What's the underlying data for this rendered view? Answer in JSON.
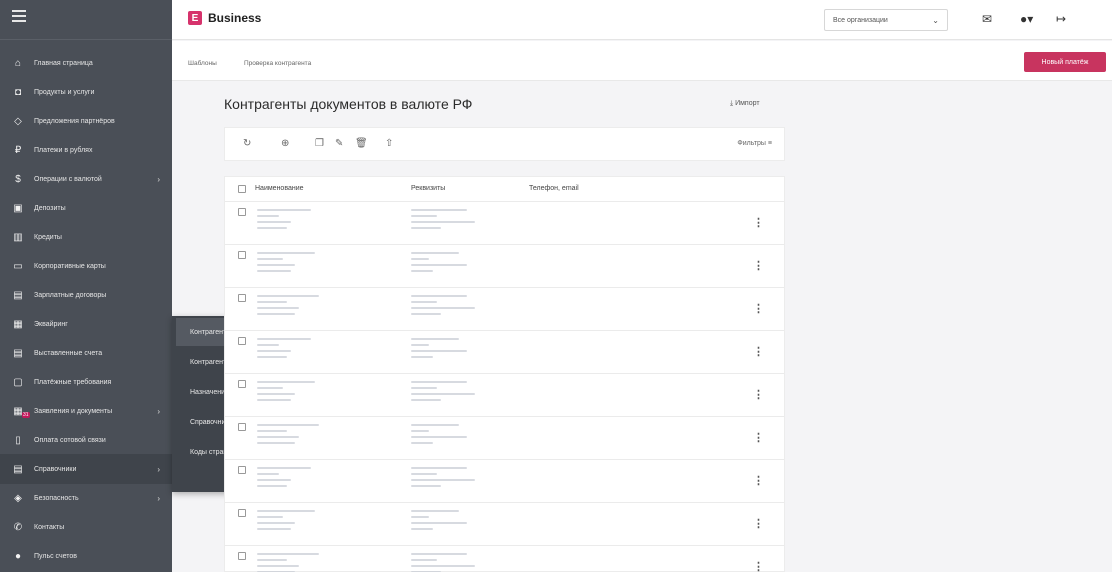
{
  "sidebar": {
    "items": [
      {
        "label": "Главная страница",
        "icon": "home-icon"
      },
      {
        "label": "Продукты и услуги",
        "icon": "bag-icon"
      },
      {
        "label": "Предложения партнёров",
        "icon": "tag-icon"
      },
      {
        "label": "Платежи в рублях",
        "icon": "ruble-icon"
      },
      {
        "label": "Операции с валютой",
        "icon": "dollar-icon",
        "has_arrow": true
      },
      {
        "label": "Депозиты",
        "icon": "deposit-icon"
      },
      {
        "label": "Кредиты",
        "icon": "credit-icon"
      },
      {
        "label": "Корпоративные карты",
        "icon": "card-icon"
      },
      {
        "label": "Зарплатные договоры",
        "icon": "salary-icon"
      },
      {
        "label": "Эквайринг",
        "icon": "pos-icon"
      },
      {
        "label": "Выставленные счета",
        "icon": "invoice-icon"
      },
      {
        "label": "Платёжные требования",
        "icon": "request-icon"
      },
      {
        "label": "Заявления и документы",
        "icon": "documents-icon",
        "has_arrow": true,
        "badge": "31"
      },
      {
        "label": "Оплата сотовой связи",
        "icon": "phone-icon"
      },
      {
        "label": "Справочники",
        "icon": "book-icon",
        "has_arrow": true,
        "active": true
      },
      {
        "label": "Безопасность",
        "icon": "shield-icon",
        "has_arrow": true
      },
      {
        "label": "Контакты",
        "icon": "contacts-icon"
      },
      {
        "label": "Пульс счетов",
        "icon": "pulse-icon"
      }
    ]
  },
  "submenu": {
    "items": [
      "Контрагенты по платежам в рублях",
      "Контрагенты по платежам в валюте",
      "Назначения платежей",
      "Справочник банков",
      "Коды стран"
    ]
  },
  "header": {
    "brand": "Business",
    "logo_letter": "E",
    "org_select": "Все организации"
  },
  "breadcrumbs": [
    "Шаблоны",
    "Проверка контрагента"
  ],
  "new_payment": "Новый платёж",
  "main": {
    "title": "Контрагенты документов в валюте РФ",
    "import": "Импорт",
    "filters": "Фильтры"
  },
  "table": {
    "columns": [
      "Наименование",
      "Реквизиты",
      "Телефон, email"
    ],
    "row_count": 9
  },
  "colors": {
    "sidebar": "#4a4f57",
    "accent": "#c8345f"
  }
}
